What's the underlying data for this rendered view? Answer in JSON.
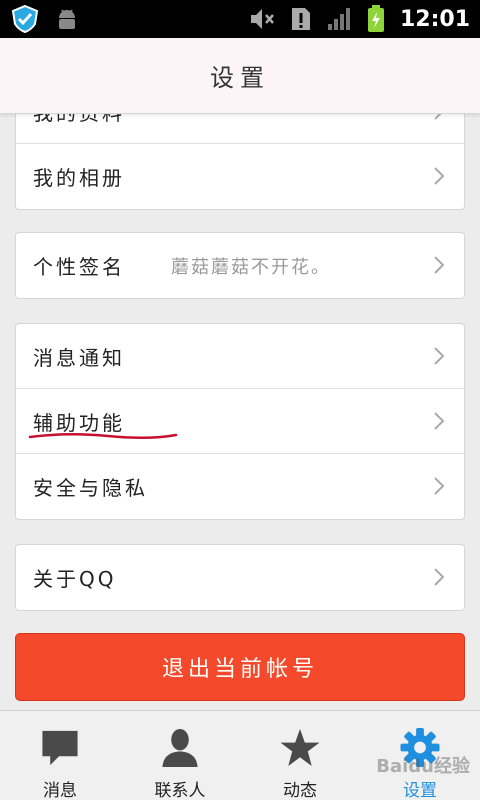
{
  "status_bar": {
    "time": "12:01",
    "icons": [
      "qq-shield-icon",
      "android-debug-icon",
      "mute-icon",
      "alert-icon",
      "signal-icon",
      "battery-charging-icon"
    ]
  },
  "header": {
    "title": "设置"
  },
  "groups": [
    {
      "items": [
        {
          "label": "我的资料"
        },
        {
          "label": "我的相册"
        }
      ]
    },
    {
      "items": [
        {
          "label": "个性签名",
          "value": "蘑菇蘑菇不开花。"
        }
      ]
    },
    {
      "items": [
        {
          "label": "消息通知"
        },
        {
          "label": "辅助功能"
        },
        {
          "label": "安全与隐私"
        }
      ]
    },
    {
      "items": [
        {
          "label": "关于QQ"
        }
      ]
    }
  ],
  "logout_button": {
    "label": "退出当前帐号"
  },
  "tabs": [
    {
      "label": "消息",
      "icon": "chat-bubble-icon",
      "active": false
    },
    {
      "label": "联系人",
      "icon": "person-icon",
      "active": false
    },
    {
      "label": "动态",
      "icon": "star-icon",
      "active": false
    },
    {
      "label": "设置",
      "icon": "gear-icon",
      "active": true
    }
  ],
  "watermark": {
    "text": "Baidu经验"
  },
  "colors": {
    "accent": "#1f8fe0",
    "logout": "#f4492b",
    "annotation": "#c8102e"
  }
}
